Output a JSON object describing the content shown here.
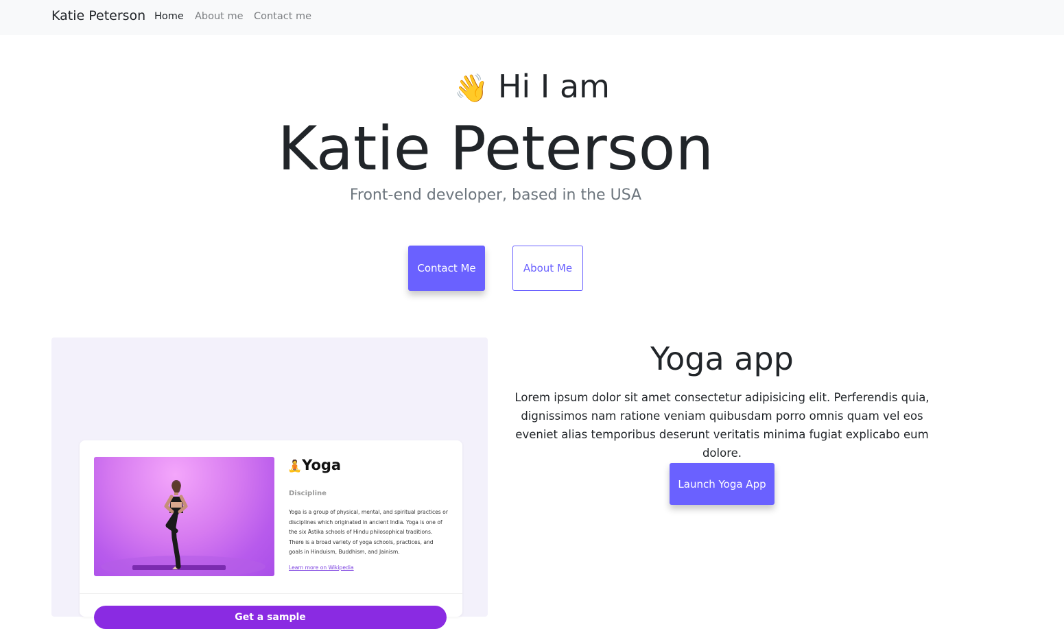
{
  "navbar": {
    "brand": "Katie Peterson",
    "links": [
      {
        "label": "Home",
        "active": true
      },
      {
        "label": "About me",
        "active": false
      },
      {
        "label": "Contact me",
        "active": false
      }
    ]
  },
  "hero": {
    "greeting": "Hi I am",
    "wave_icon": "👋",
    "name": "Katie Peterson",
    "subtitle": "Front-end developer, based in the USA",
    "contact_button": "Contact Me",
    "about_button": "About Me"
  },
  "project": {
    "title": "Yoga app",
    "description": "Lorem ipsum dolor sit amet consectetur adipisicing elit. Perferendis quia, dignissimos nam ratione veniam quibusdam porro omnis quam vel eos eveniet alias temporibus deserunt veritatis minima fugiat explicabo eum dolore.",
    "launch_button": "Launch Yoga App",
    "preview": {
      "icon": "🧘",
      "title": "Yoga",
      "discipline_label": "Discipline",
      "description": "Yoga is a group of physical, mental, and spiritual practices or disciplines which originated in ancient India. Yoga is one of the six Āstika schools of Hindu philosophical traditions. There is a broad variety of yoga schools, practices, and goals in Hinduism, Buddhism, and Jainism.",
      "link": "Learn more on Wikipedia",
      "button": "Get a sample"
    }
  },
  "colors": {
    "accent": "#6a61ff",
    "preview_bg": "#f3f1fb",
    "preview_button": "#8a2be2",
    "navbar_bg": "#f8f9fa"
  }
}
